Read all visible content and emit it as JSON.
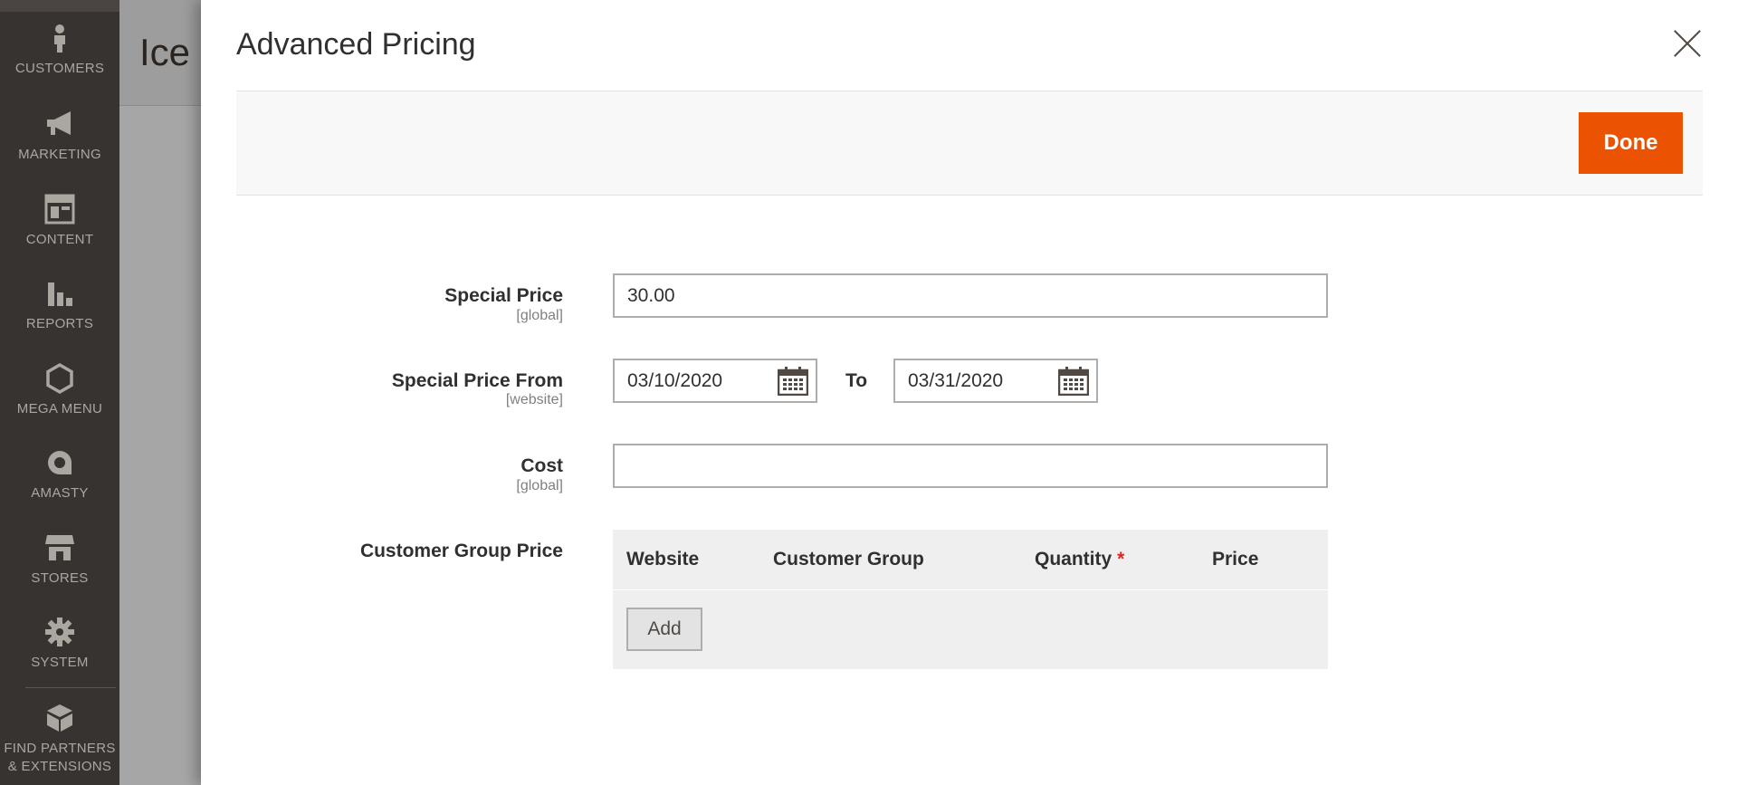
{
  "sidebar": {
    "items": [
      {
        "label": "CUSTOMERS",
        "icon": "person-icon"
      },
      {
        "label": "MARKETING",
        "icon": "megaphone-icon"
      },
      {
        "label": "CONTENT",
        "icon": "layout-icon"
      },
      {
        "label": "REPORTS",
        "icon": "bar-chart-icon"
      },
      {
        "label": "MEGA MENU",
        "icon": "hexagon-icon"
      },
      {
        "label": "AMASTY",
        "icon": "amasty-logo-icon"
      },
      {
        "label": "STORES",
        "icon": "storefront-icon"
      },
      {
        "label": "SYSTEM",
        "icon": "gear-icon"
      }
    ],
    "partners": {
      "line1": "FIND PARTNERS",
      "line2": "& EXTENSIONS",
      "icon": "blocks-icon"
    }
  },
  "page": {
    "title_partial": "Ice"
  },
  "modal": {
    "title": "Advanced Pricing",
    "done_label": "Done",
    "fields": {
      "special_price": {
        "label": "Special Price",
        "scope": "[global]",
        "value": "30.00"
      },
      "special_price_from": {
        "label": "Special Price From",
        "scope": "[website]",
        "from_value": "03/10/2020",
        "to_label": "To",
        "to_value": "03/31/2020"
      },
      "cost": {
        "label": "Cost",
        "scope": "[global]",
        "value": ""
      },
      "customer_group_price": {
        "label": "Customer Group Price",
        "columns": {
          "website": "Website",
          "customer_group": "Customer Group",
          "quantity": "Quantity",
          "required_mark": "*",
          "price": "Price"
        },
        "add_label": "Add"
      }
    }
  },
  "colors": {
    "sidebar_bg": "#373330",
    "accent": "#eb5202",
    "required": "#e22626"
  }
}
